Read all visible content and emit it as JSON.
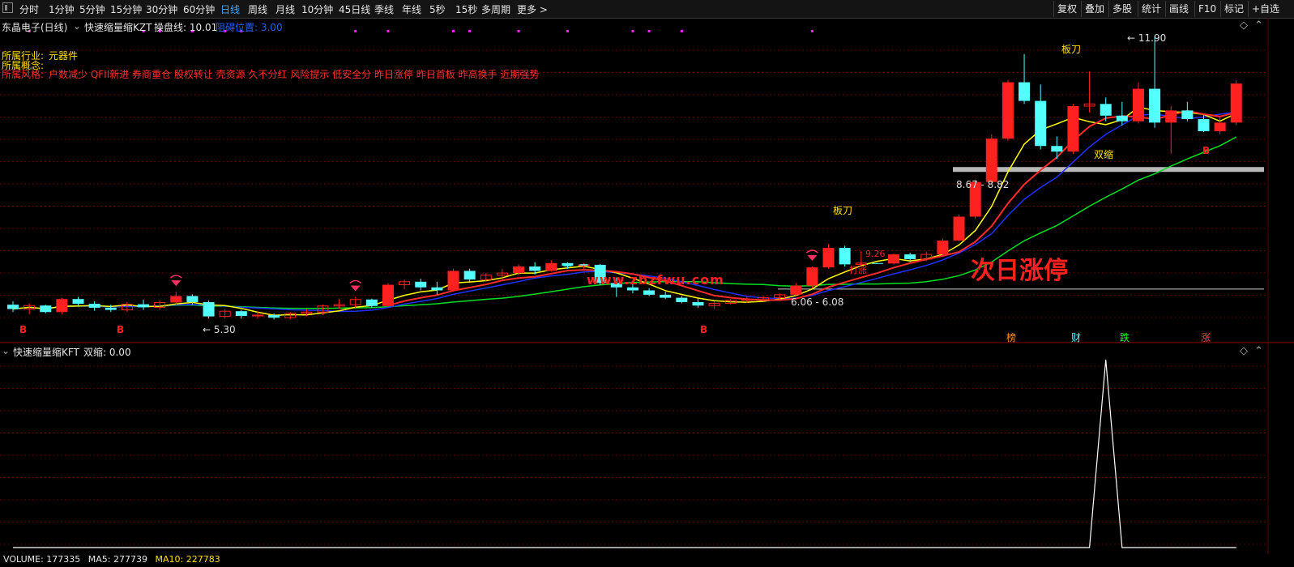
{
  "toolbar": {
    "periods": [
      "分时",
      "1分钟",
      "5分钟",
      "15分钟",
      "30分钟",
      "60分钟",
      "日线",
      "周线",
      "月线",
      "10分钟",
      "45日线",
      "季线",
      "年线",
      "5秒",
      "15秒",
      "多周期",
      "更多 >"
    ],
    "active_period": "日线",
    "right_buttons": [
      "复权",
      "叠加",
      "多股",
      "统计",
      "画线",
      "F10",
      "标记",
      "+自选"
    ]
  },
  "header": {
    "stock_title": "东晶电子(日线)",
    "indicator_name": "快速缩量缩KZT",
    "cost_line_label": "操盘线: 10.01",
    "position_label": "阻碍位置: 3.00"
  },
  "info": {
    "industry_key": "所属行业:",
    "industry_value": "元器件",
    "concept_key": "所属概念:",
    "style_key": "所属风格:",
    "style_value": "户数减少 QFII新进 券商重仓 股权转让 壳资源 久不分红 风险提示 低安全分 昨日涨停 昨日首板 昨高换手 近期强势"
  },
  "annotations": {
    "blade_1": "板刀",
    "blade_2": "板刀",
    "double_shrink": "双缩",
    "next_day_limit_up": "次日涨停",
    "watermark": "www.zbzfwu.com",
    "price_low": "5.30",
    "price_high": "11.90",
    "range_1": "6.06 - 6.08",
    "range_2": "8.67 - 8.82",
    "near_level": "9.26",
    "trap": "打涨",
    "b_signals": [
      "B",
      "B",
      "B",
      "B"
    ],
    "bottom_tags": [
      "榜",
      "财",
      "跌",
      "涨"
    ]
  },
  "sub_indicator": {
    "name": "快速缩量缩KFT",
    "value_label": "双缩: 0.00"
  },
  "status_bar": {
    "volume": "VOLUME: 177335",
    "ma5": "MA5: 277739",
    "ma10": "MA10: 227783"
  },
  "colors": {
    "up": "#ff2020",
    "down": "#54ffff",
    "ma_short": "#ffff00",
    "ma_mid": "#2030ff",
    "ma_long": "#00e020",
    "trend": "#ff2a2a",
    "grid": "#5a0000",
    "active_tab": "#3fa9ff"
  },
  "chart_data": {
    "type": "candlestick",
    "ohlc": [
      [
        5.72,
        5.8,
        5.55,
        5.62
      ],
      [
        5.62,
        5.75,
        5.5,
        5.7
      ],
      [
        5.7,
        5.72,
        5.52,
        5.55
      ],
      [
        5.55,
        5.88,
        5.5,
        5.85
      ],
      [
        5.85,
        5.9,
        5.7,
        5.74
      ],
      [
        5.74,
        5.8,
        5.58,
        5.65
      ],
      [
        5.65,
        5.72,
        5.55,
        5.6
      ],
      [
        5.6,
        5.78,
        5.55,
        5.73
      ],
      [
        5.73,
        5.84,
        5.6,
        5.66
      ],
      [
        5.66,
        5.82,
        5.6,
        5.77
      ],
      [
        5.77,
        6.02,
        5.7,
        5.92
      ],
      [
        5.92,
        5.96,
        5.72,
        5.78
      ],
      [
        5.78,
        5.82,
        5.4,
        5.45
      ],
      [
        5.45,
        5.62,
        5.4,
        5.57
      ],
      [
        5.57,
        5.6,
        5.4,
        5.46
      ],
      [
        5.46,
        5.58,
        5.4,
        5.48
      ],
      [
        5.48,
        5.52,
        5.38,
        5.42
      ],
      [
        5.42,
        5.55,
        5.38,
        5.52
      ],
      [
        5.52,
        5.62,
        5.45,
        5.55
      ],
      [
        5.55,
        5.72,
        5.48,
        5.69
      ],
      [
        5.69,
        5.85,
        5.62,
        5.72
      ],
      [
        5.72,
        5.9,
        5.65,
        5.84
      ],
      [
        5.84,
        5.86,
        5.65,
        5.69
      ],
      [
        5.69,
        6.22,
        5.66,
        6.18
      ],
      [
        6.18,
        6.3,
        6.08,
        6.25
      ],
      [
        6.25,
        6.32,
        6.05,
        6.12
      ],
      [
        6.12,
        6.25,
        5.95,
        6.05
      ],
      [
        6.05,
        6.55,
        6.02,
        6.5
      ],
      [
        6.5,
        6.55,
        6.25,
        6.3
      ],
      [
        6.3,
        6.45,
        6.25,
        6.4
      ],
      [
        6.4,
        6.55,
        6.3,
        6.45
      ],
      [
        6.45,
        6.65,
        6.4,
        6.6
      ],
      [
        6.6,
        6.7,
        6.42,
        6.5
      ],
      [
        6.5,
        6.75,
        6.48,
        6.68
      ],
      [
        6.68,
        6.7,
        6.55,
        6.62
      ],
      [
        6.62,
        6.68,
        6.55,
        6.64
      ],
      [
        6.64,
        6.66,
        6.18,
        6.22
      ],
      [
        6.22,
        6.35,
        5.9,
        6.12
      ],
      [
        6.12,
        6.2,
        5.98,
        6.05
      ],
      [
        6.05,
        6.1,
        5.92,
        5.95
      ],
      [
        5.95,
        6.02,
        5.85,
        5.88
      ],
      [
        5.88,
        5.92,
        5.75,
        5.78
      ],
      [
        5.78,
        5.85,
        5.65,
        5.7
      ],
      [
        5.7,
        5.8,
        5.62,
        5.75
      ],
      [
        5.75,
        5.85,
        5.72,
        5.82
      ],
      [
        5.82,
        5.9,
        5.76,
        5.84
      ],
      [
        5.84,
        5.92,
        5.8,
        5.88
      ],
      [
        5.88,
        5.98,
        5.84,
        5.95
      ],
      [
        5.95,
        6.22,
        5.92,
        6.16
      ],
      [
        6.16,
        6.6,
        6.1,
        6.58
      ],
      [
        6.58,
        7.12,
        6.55,
        7.03
      ],
      [
        7.03,
        7.08,
        6.6,
        6.65
      ],
      [
        6.65,
        6.95,
        6.62,
        6.68
      ],
      [
        6.68,
        6.68,
        6.66,
        6.67
      ],
      [
        6.67,
        6.9,
        6.65,
        6.88
      ],
      [
        6.88,
        6.92,
        6.7,
        6.77
      ],
      [
        6.77,
        6.95,
        6.72,
        6.88
      ],
      [
        6.88,
        7.25,
        6.85,
        7.2
      ],
      [
        7.2,
        7.8,
        7.18,
        7.75
      ],
      [
        7.75,
        8.6,
        7.7,
        8.55
      ],
      [
        8.55,
        9.65,
        8.5,
        9.55
      ],
      [
        9.55,
        10.9,
        9.5,
        10.85
      ],
      [
        10.85,
        11.5,
        10.35,
        10.42
      ],
      [
        10.42,
        10.8,
        9.3,
        9.38
      ],
      [
        9.38,
        9.6,
        9.08,
        9.25
      ],
      [
        9.25,
        10.35,
        9.2,
        10.3
      ],
      [
        10.3,
        11.1,
        10.15,
        10.35
      ],
      [
        10.35,
        10.5,
        9.95,
        10.08
      ],
      [
        10.08,
        10.4,
        9.85,
        9.95
      ],
      [
        9.95,
        10.85,
        9.9,
        10.7
      ],
      [
        10.7,
        11.9,
        9.8,
        9.92
      ],
      [
        9.92,
        10.3,
        9.2,
        10.2
      ],
      [
        10.2,
        10.4,
        9.95,
        10.0
      ],
      [
        10.0,
        10.1,
        9.7,
        9.72
      ],
      [
        9.72,
        10.05,
        9.65,
        9.92
      ],
      [
        9.92,
        10.9,
        9.86,
        10.82
      ]
    ],
    "xlabel": "",
    "ylabel": "",
    "ylim": [
      5.2,
      12.0
    ],
    "grid": true,
    "volume_shrink_signal": [
      0,
      0,
      0,
      0,
      0,
      0,
      0,
      0,
      0,
      0,
      0,
      0,
      0,
      0,
      0,
      0,
      0,
      0,
      0,
      0,
      0,
      0,
      0,
      0,
      0,
      0,
      0,
      0,
      0,
      0,
      0,
      0,
      0,
      0,
      0,
      0,
      0,
      0,
      0,
      0,
      0,
      0,
      0,
      0,
      0,
      0,
      0,
      0,
      0,
      0,
      0,
      0,
      0,
      0,
      0,
      0,
      0,
      0,
      0,
      0,
      0,
      0,
      0,
      0,
      0,
      0,
      0,
      1,
      0,
      0,
      0,
      0,
      0,
      0,
      0,
      0
    ]
  }
}
